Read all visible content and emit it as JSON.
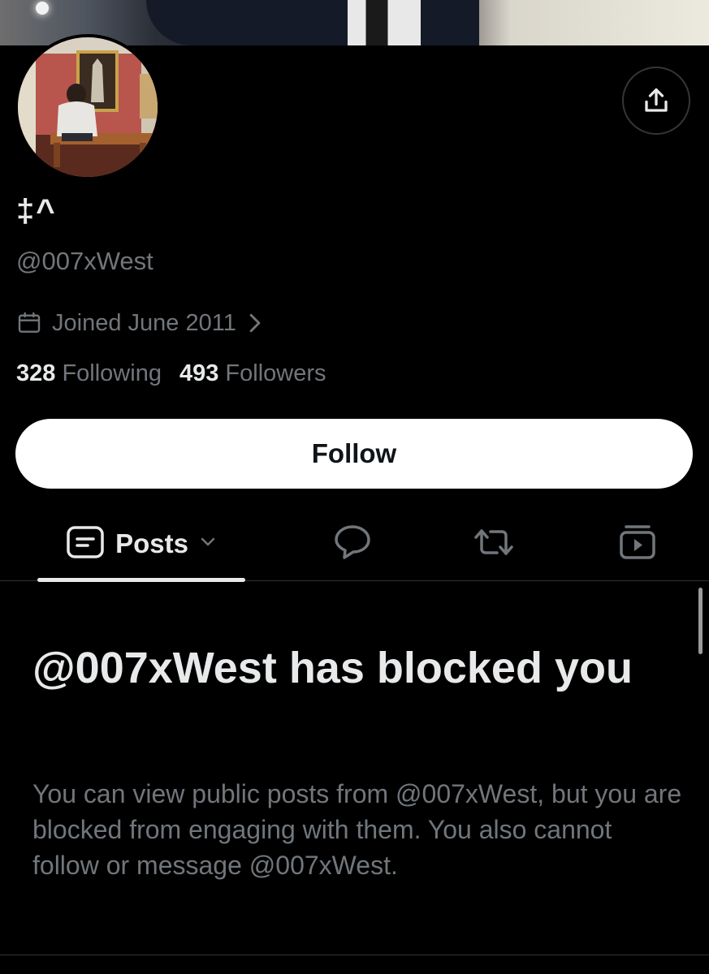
{
  "profile": {
    "display_name": "‡^",
    "handle": "@007xWest",
    "joined": "Joined June 2011",
    "following_count": "328",
    "following_label": "Following",
    "followers_count": "493",
    "followers_label": "Followers"
  },
  "actions": {
    "follow_label": "Follow"
  },
  "tabs": {
    "posts_label": "Posts"
  },
  "blocked": {
    "title": "@007xWest has blocked you",
    "description": "You can view public posts from @007xWest, but you are blocked from engaging with them. You also cannot follow or message @007xWest."
  },
  "icons": {
    "share": "share-icon",
    "calendar": "calendar-icon",
    "chevron": "chevron-right-icon",
    "posts": "posts-icon",
    "posts_dropdown": "chevron-down-icon",
    "replies": "reply-bubble-icon",
    "reposts": "repost-icon",
    "media": "media-icon"
  },
  "colors": {
    "background": "#000000",
    "primary_text": "#e7e9ea",
    "secondary_text": "#71767b",
    "divider": "#2f3336",
    "follow_button_bg": "#ffffff"
  }
}
